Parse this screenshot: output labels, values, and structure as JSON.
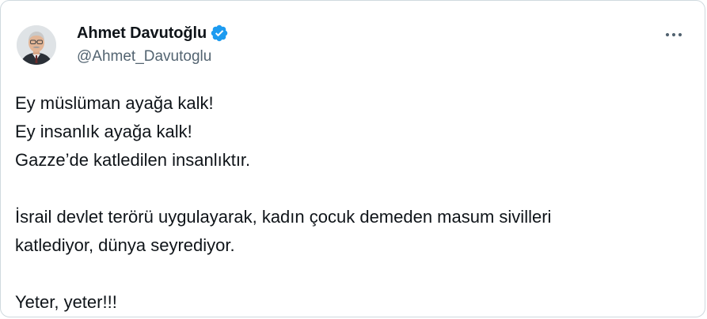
{
  "author": {
    "display_name": "Ahmet Davutoğlu",
    "handle": "@Ahmet_Davutoglu",
    "verified": true,
    "verified_color": "#1d9bf0",
    "avatar_icon": "profile-photo"
  },
  "menu": {
    "icon": "more-horizontal-icon"
  },
  "tweet": {
    "lines": [
      "Ey müslüman ayağa kalk!",
      "Ey insanlık ayağa kalk!",
      "Gazze’de katledilen insanlıktır.",
      "İsrail devlet terörü uygulayarak, kadın çocuk demeden masum sivilleri",
      "katlediyor, dünya seyrediyor.",
      "Yeter, yeter!!!"
    ]
  }
}
